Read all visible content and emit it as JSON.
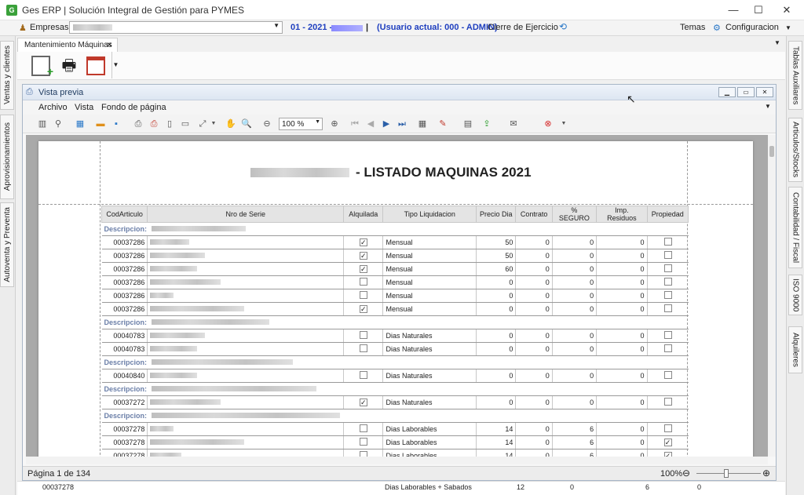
{
  "app": {
    "title": "Ges ERP | Solución Integral de Gestión para PYMES",
    "icon": "app-logo-icon"
  },
  "menubar": {
    "empresas_label": "Empresas",
    "period": "01 - 2021 -",
    "user": "(Usuario actual: 000 - ADMIN)",
    "cierre": "Cierre de Ejercicio",
    "temas": "Temas",
    "config": "Configuracion"
  },
  "left_tabs": [
    "Ventas y clientes",
    "Aprovisionamientos",
    "Autoventa y Preventa"
  ],
  "right_tabs": [
    "Tablas Auxiliares",
    "Articulos/Stocks",
    "Contabilidad / Fiscal",
    "ISO 9000",
    "Alquileres"
  ],
  "doc_tab": {
    "label": "Mantenimiento Máquinas",
    "close": "✕"
  },
  "preview": {
    "title": "Vista previa",
    "menu": [
      "Archivo",
      "Vista",
      "Fondo de página"
    ],
    "zoom_value": "100 %",
    "page_status": "Página 1 de 134",
    "zoom_percent": "100%"
  },
  "report": {
    "title": "- LISTADO MAQUINAS 2021",
    "headers": [
      "CodArticulo",
      "Nro de Serie",
      "Alquilada",
      "Tipo Liquidacion",
      "Precio Dia",
      "Contrato",
      "% SEGURO",
      "Imp. Residuos",
      "Propiedad"
    ],
    "desc_label": "Descripcion:",
    "groups": [
      {
        "rows": [
          [
            "00037286",
            true,
            "Mensual",
            "50",
            "0",
            "0",
            "0",
            false
          ],
          [
            "00037286",
            true,
            "Mensual",
            "50",
            "0",
            "0",
            "0",
            false
          ],
          [
            "00037286",
            true,
            "Mensual",
            "60",
            "0",
            "0",
            "0",
            false
          ],
          [
            "00037286",
            false,
            "Mensual",
            "0",
            "0",
            "0",
            "0",
            false
          ],
          [
            "00037286",
            false,
            "Mensual",
            "0",
            "0",
            "0",
            "0",
            false
          ],
          [
            "00037286",
            true,
            "Mensual",
            "0",
            "0",
            "0",
            "0",
            false
          ]
        ]
      },
      {
        "rows": [
          [
            "00040783",
            false,
            "Dias Naturales",
            "0",
            "0",
            "0",
            "0",
            false
          ],
          [
            "00040783",
            false,
            "Dias Naturales",
            "0",
            "0",
            "0",
            "0",
            false
          ]
        ]
      },
      {
        "rows": [
          [
            "00040840",
            false,
            "Dias Naturales",
            "0",
            "0",
            "0",
            "0",
            false
          ]
        ]
      },
      {
        "rows": [
          [
            "00037272",
            true,
            "Dias Naturales",
            "0",
            "0",
            "0",
            "0",
            false
          ]
        ]
      },
      {
        "rows": [
          [
            "00037278",
            false,
            "Dias Laborables",
            "14",
            "0",
            "6",
            "0",
            false
          ],
          [
            "00037278",
            false,
            "Dias Laborables",
            "14",
            "0",
            "6",
            "0",
            true
          ],
          [
            "00037278",
            false,
            "Dias Laborables",
            "14",
            "0",
            "6",
            "0",
            true
          ],
          [
            "00037278",
            true,
            "Dias Laborables + Sabados",
            "0",
            "0",
            "6",
            "0",
            false
          ]
        ]
      }
    ]
  },
  "behind_row": {
    "code": "00037278",
    "tipo": "Dias Laborables + Sabados",
    "precio": "12",
    "contrato": "0",
    "seguro": "6",
    "residuos": "0"
  }
}
